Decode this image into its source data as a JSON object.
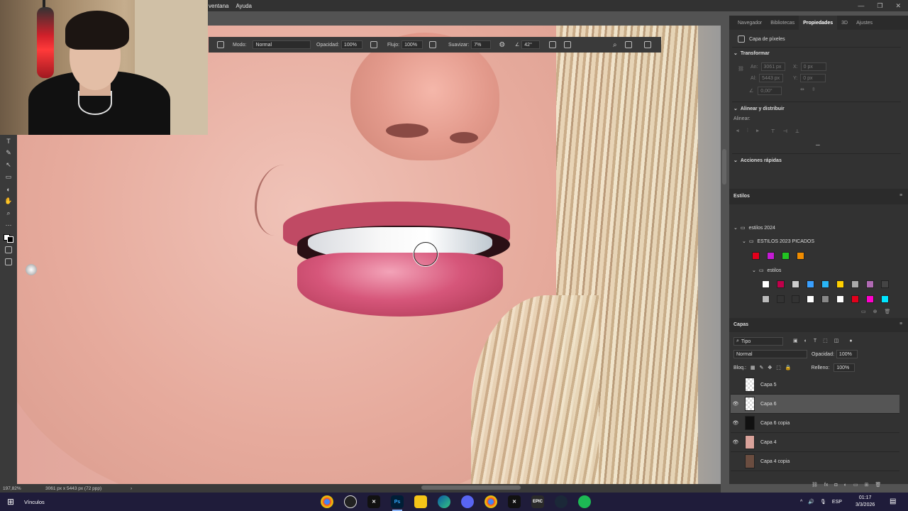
{
  "menubar": {
    "items": [
      "ventana",
      "Ayuda"
    ]
  },
  "window_controls": {
    "minimize": "—",
    "maximize": "❐",
    "close": "✕"
  },
  "options_bar": {
    "mode_label": "Modo:",
    "mode_value": "Normal",
    "opacity_label": "Opacidad:",
    "opacity_value": "100%",
    "flow_label": "Flujo:",
    "flow_value": "100%",
    "smooth_label": "Suavizar:",
    "smooth_value": "7%",
    "angle_value": "42°"
  },
  "panel_tabs": [
    "Navegador",
    "Bibliotecas",
    "Propiedades",
    "3D",
    "Ajustes"
  ],
  "active_tab": "Propiedades",
  "properties": {
    "layer_type": "Capa de píxeles",
    "transform_title": "Transformar",
    "w_label": "An:",
    "w_value": "3061 px",
    "x_label": "X:",
    "x_value": "0 px",
    "h_label": "Al:",
    "h_value": "5443 px",
    "y_label": "Y:",
    "y_value": "0 px",
    "angle_value": "0,00°",
    "align_title": "Alinear y distribuir",
    "align_label": "Alinear:",
    "more": "...",
    "quick_actions_title": "Acciones rápidas"
  },
  "styles": {
    "panel_title": "Estilos",
    "group1": "estilos 2024",
    "group2": "ESTILOS 2023 PICADOS",
    "subgroup": "estilos",
    "row1_colors": [
      "#e3001b",
      "#c41bd4",
      "#22c422",
      "#f08c00"
    ],
    "row2_colors": [
      "#ffffff",
      "#c0004a",
      "#cccccc",
      "#3aa0ff",
      "#29b6f6",
      "#ffd000",
      "#aaaaaa",
      "#b06ab3",
      "#444444"
    ],
    "row3_colors": [
      "#bbbbbb",
      "#333333",
      "#333333",
      "#ffffff",
      "#888888",
      "#ffffff",
      "#e3001b",
      "#ff00cc",
      "#00e5ff"
    ]
  },
  "layers": {
    "panel_title": "Capas",
    "filter_label": "Tipo",
    "blend_mode": "Normal",
    "opacity_label": "Opacidad:",
    "opacity_value": "100%",
    "lock_label": "Bloq.:",
    "fill_label": "Relleno:",
    "fill_value": "100%",
    "items": [
      {
        "name": "Capa 5",
        "visible": false,
        "selected": false
      },
      {
        "name": "Capa 6",
        "visible": true,
        "selected": true
      },
      {
        "name": "Capa 6 copia",
        "visible": true,
        "selected": false
      },
      {
        "name": "Capa 4",
        "visible": true,
        "selected": false
      },
      {
        "name": "Capa 4 copia",
        "visible": false,
        "selected": false
      }
    ]
  },
  "status_bar": {
    "zoom": "197,82%",
    "doc_size": "3061 px x 5443 px (72 ppp)",
    "arrow": "›"
  },
  "taskbar": {
    "search_label": "Vínculos",
    "apps": [
      "Chrome",
      "OBS",
      "CapCut",
      "Ps",
      "Explorador",
      "Edge",
      "Discord",
      "Chrome",
      "CapCut",
      "Epic",
      "Steam",
      "Spotify"
    ],
    "lang": "ESP",
    "time": "01:17",
    "date": "3/3/2026"
  },
  "tools": [
    "T",
    "✎",
    "↖",
    "▭",
    "◐",
    "✋",
    "⌕",
    "⋯"
  ]
}
